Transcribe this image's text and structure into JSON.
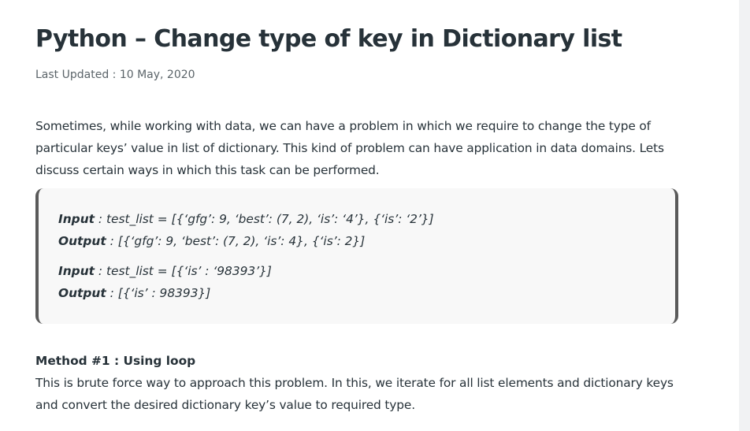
{
  "article": {
    "title": "Python – Change type of key in Dictionary list",
    "last_updated": "Last Updated : 10 May, 2020",
    "intro": "Sometimes, while working with data, we can have a problem in which we require to change the type of particular keys’ value in list of dictionary. This kind of problem can have application in data domains. Lets discuss certain ways in which this task can be performed.",
    "examples": [
      {
        "label": "Input",
        "text": " : test_list = [{‘gfg’: 9, ‘best’: (7, 2), ‘is’: ‘4’}, {‘is’: ‘2’}]"
      },
      {
        "label": "Output",
        "text": " : [{‘gfg’: 9, ‘best’: (7, 2), ‘is’: 4}, {‘is’: 2}]"
      },
      {
        "label": "Input",
        "text": " : test_list = [{‘is’ : ‘98393’}]"
      },
      {
        "label": "Output",
        "text": " : [{‘is’ : 98393}]"
      }
    ],
    "method_heading": "Method #1 : Using loop",
    "method_text": "This is brute force way to approach this problem. In this, we iterate for all list elements and dictionary keys and convert the desired dictionary key’s value to required type."
  }
}
